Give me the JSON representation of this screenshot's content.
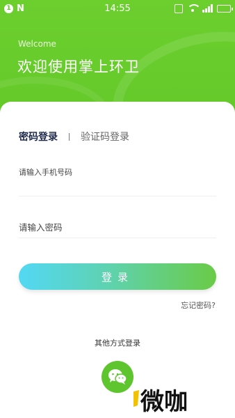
{
  "status_bar": {
    "notif_badge": "1",
    "notif_letter": "N",
    "time": "14:55"
  },
  "header": {
    "welcome": "Welcome",
    "title": "欢迎使用掌上环卫"
  },
  "tabs": {
    "active": "密码登录",
    "other": "验证码登录"
  },
  "form": {
    "phone_placeholder": "请输入手机号码",
    "password_placeholder": "请输入密码",
    "login_label": "登录",
    "forgot_label": "忘记密码?"
  },
  "other_login": {
    "label": "其他方式登录",
    "icon": "wechat-icon"
  },
  "watermark": {
    "text": "微咖"
  },
  "colors": {
    "header_green": "#62c829",
    "button_start": "#52d8f4",
    "button_end": "#6acb47",
    "wechat_green": "#5ec52f"
  }
}
